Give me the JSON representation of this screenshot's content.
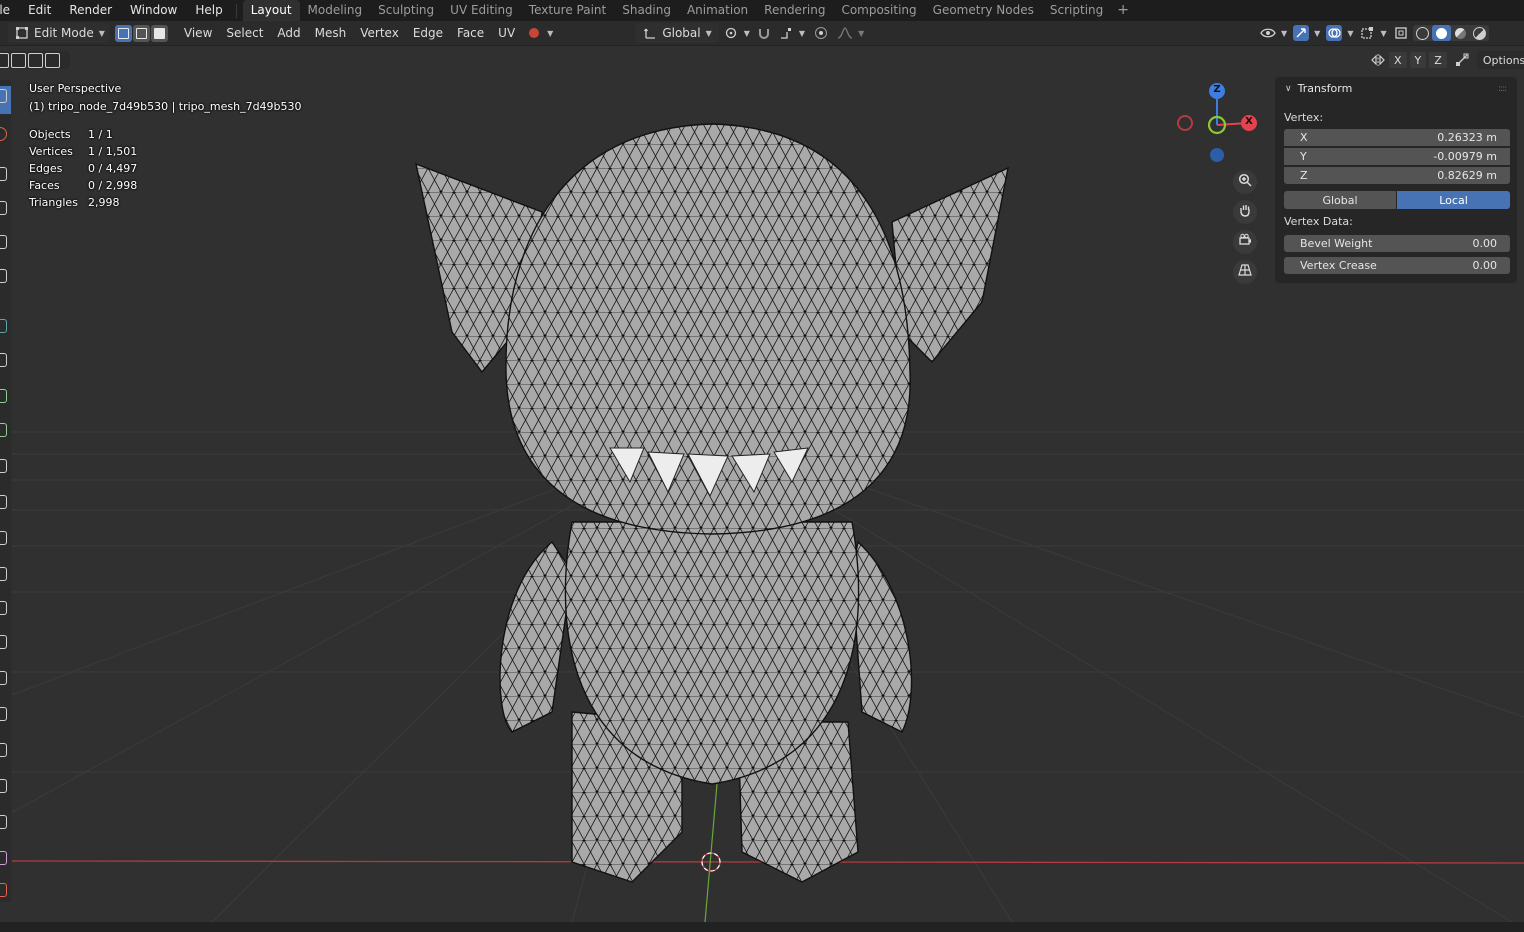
{
  "menu": [
    "ile",
    "Edit",
    "Render",
    "Window",
    "Help"
  ],
  "workspaces": [
    {
      "label": "Layout",
      "active": true
    },
    {
      "label": "Modeling",
      "active": false
    },
    {
      "label": "Sculpting",
      "active": false
    },
    {
      "label": "UV Editing",
      "active": false
    },
    {
      "label": "Texture Paint",
      "active": false
    },
    {
      "label": "Shading",
      "active": false
    },
    {
      "label": "Animation",
      "active": false
    },
    {
      "label": "Rendering",
      "active": false
    },
    {
      "label": "Compositing",
      "active": false
    },
    {
      "label": "Geometry Nodes",
      "active": false
    },
    {
      "label": "Scripting",
      "active": false
    }
  ],
  "workspace_add": "+",
  "header": {
    "mode": "Edit Mode",
    "menus": [
      "View",
      "Select",
      "Add",
      "Mesh",
      "Vertex",
      "Edge",
      "Face",
      "UV"
    ],
    "orientation": "Global",
    "options": "Options",
    "axis_toggles": [
      "X",
      "Y",
      "Z"
    ]
  },
  "overlay": {
    "view_name": "User Perspective",
    "object_line": "(1) tripo_node_7d49b530 | tripo_mesh_7d49b530",
    "stats": [
      {
        "label": "Objects",
        "value": "1 / 1"
      },
      {
        "label": "Vertices",
        "value": "1 / 1,501"
      },
      {
        "label": "Edges",
        "value": "0 / 4,497"
      },
      {
        "label": "Faces",
        "value": "0 / 2,998"
      },
      {
        "label": "Triangles",
        "value": "2,998"
      }
    ]
  },
  "gizmo": {
    "z": "Z",
    "x": "X"
  },
  "panel": {
    "title": "Transform",
    "vertex_label": "Vertex:",
    "coords": [
      {
        "axis": "X",
        "value": "0.26323 m"
      },
      {
        "axis": "Y",
        "value": "-0.00979 m"
      },
      {
        "axis": "Z",
        "value": "0.82629 m"
      }
    ],
    "space_global": "Global",
    "space_local": "Local",
    "vertex_data_label": "Vertex Data:",
    "bevel_label": "Bevel Weight",
    "bevel_value": "0.00",
    "crease_label": "Vertex Crease",
    "crease_value": "0.00"
  },
  "colors": {
    "accent": "#4772b3",
    "x_axis": "#e2434f",
    "y_axis": "#8ac936",
    "z_axis": "#3d7ee0"
  }
}
